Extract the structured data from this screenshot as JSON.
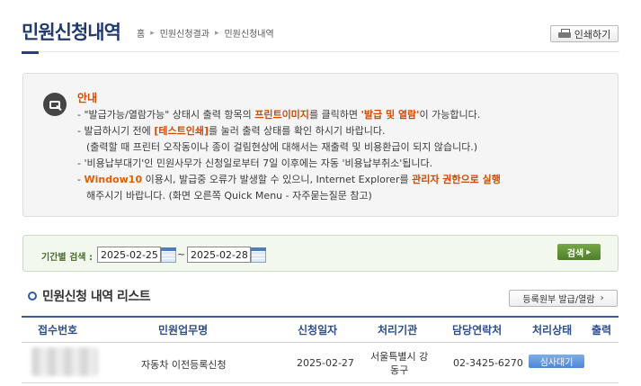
{
  "header": {
    "title": "민원신청내역",
    "breadcrumb": [
      "홈",
      "민원신청결과",
      "민원신청내역"
    ],
    "print_label": "인쇄하기"
  },
  "notice": {
    "title": "안내",
    "lines": [
      [
        {
          "t": "- \"발급가능/열람가능\" 상태시 출력 항목의 ",
          "s": ""
        },
        {
          "t": "프린트이미지",
          "s": "hl"
        },
        {
          "t": "를 클릭하면 ",
          "s": ""
        },
        {
          "t": "'발급 및 열람'",
          "s": "hl"
        },
        {
          "t": "이 가능합니다.",
          "s": ""
        }
      ],
      [
        {
          "t": "- 발급하시기 전에 ",
          "s": ""
        },
        {
          "t": "[테스트인쇄]",
          "s": "hl"
        },
        {
          "t": "를 눌러 출력 상태를 확인 하시기 바랍니다.",
          "s": ""
        }
      ],
      [
        {
          "t": "(출력할 때 프린터 오작동이나 종이 걸림현상에 대해서는 재출력 및 비용환급이 되지 않습니다.)",
          "s": "indent"
        }
      ],
      [
        {
          "t": "- '비용납부대기'인 민원사무가 신청일로부터 7일 이후에는 자동 '비용납부취소'됩니다.",
          "s": ""
        }
      ],
      [
        {
          "t": "- ",
          "s": ""
        },
        {
          "t": "Window10",
          "s": "hl2"
        },
        {
          "t": " 이용시, 발급중 오류가 발생할 수 있으니, Internet Explorer를 ",
          "s": ""
        },
        {
          "t": "관리자 권한으로 실행",
          "s": "hl"
        }
      ],
      [
        {
          "t": "해주시기 바랍니다. (화면 오른쪽 Quick Menu - 자주묻는질문 참고)",
          "s": "indent"
        }
      ]
    ]
  },
  "search": {
    "label": "기간별 검색 :",
    "start_date": "2025-02-25",
    "separator": "~",
    "end_date": "2025-02-28",
    "button_label": "검색"
  },
  "list": {
    "title": "민원신청 내역 리스트",
    "register_button": "등록원부 발급/열람",
    "columns": [
      "접수번호",
      "민원업무명",
      "신청일자",
      "처리기관",
      "담당연락처",
      "처리상태",
      "출력"
    ],
    "rows": [
      {
        "receipt_no": "",
        "service_name": "자동차 이전등록신청",
        "date": "2025-02-27",
        "agency_line1": "서울특별시 강",
        "agency_line2": "동구",
        "phone": "02-3425-6270",
        "status": "심사대기",
        "output": ""
      }
    ]
  },
  "colors": {
    "title": "#223a6e",
    "accent_orange": "#d24a00",
    "search_bg": "#f3f8ef",
    "search_button": "#5b8e33",
    "table_header": "#2d4e8a",
    "status_button": "#5b93dc"
  }
}
